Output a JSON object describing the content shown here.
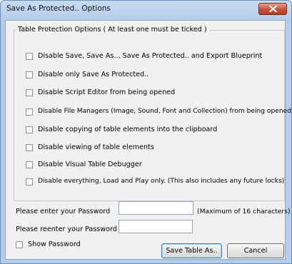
{
  "window": {
    "title": "Save As Protected.. Options"
  },
  "protection_group": {
    "legend": "Table Protection Options ( At least one must be ticked )",
    "options": [
      {
        "label": "Disable Save, Save As.., Save As Protected.. and Export Blueprint",
        "checked": false
      },
      {
        "label": "Disable only Save As Protected..",
        "checked": false
      },
      {
        "label": "Disable Script Editor from being opened",
        "checked": false
      },
      {
        "label": "Disable File Managers (Image, Sound, Font and Collection) from being opened",
        "checked": false
      },
      {
        "label": "Disable copying of table elements into the clipboard",
        "checked": false
      },
      {
        "label": "Disable viewing of table elements",
        "checked": false
      },
      {
        "label": "Disable Visual Table Debugger",
        "checked": false
      },
      {
        "label": "Disable everything, Load and Play only. (This also includes any future locks)",
        "checked": false
      }
    ]
  },
  "password": {
    "enter_label": "Please enter your Password",
    "enter_value": "",
    "max_hint": "(Maximum of 16 characters)",
    "reenter_label": "Please reenter your Password",
    "reenter_value": "",
    "show_label": "Show Password",
    "show_checked": false
  },
  "buttons": {
    "save_label": "Save Table As..",
    "cancel_label": "Cancel"
  }
}
